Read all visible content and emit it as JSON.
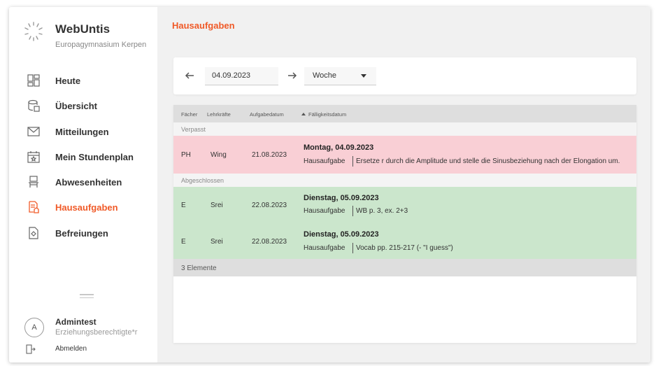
{
  "brand": {
    "name": "WebUntis",
    "school": "Europagymnasium Kerpen"
  },
  "nav": {
    "items": [
      {
        "label": "Heute",
        "icon": "dashboard-icon"
      },
      {
        "label": "Übersicht",
        "icon": "overview-icon"
      },
      {
        "label": "Mitteilungen",
        "icon": "mail-icon"
      },
      {
        "label": "Mein Stundenplan",
        "icon": "calendar-icon"
      },
      {
        "label": "Abwesenheiten",
        "icon": "chair-icon"
      },
      {
        "label": "Hausaufgaben",
        "icon": "homework-icon",
        "active": true
      },
      {
        "label": "Befreiungen",
        "icon": "exemption-icon"
      }
    ]
  },
  "user": {
    "initial": "A",
    "name": "Admintest",
    "role": "Erziehungsberechtigte*r"
  },
  "logout": {
    "label": "Abmelden"
  },
  "page": {
    "title": "Hausaufgaben"
  },
  "toolbar": {
    "date": "04.09.2023",
    "range": "Woche"
  },
  "table": {
    "headers": {
      "subject": "Fächer",
      "teacher": "Lehrkräfte",
      "assigned": "Aufgabedatum",
      "due": "Fälligkeitsdatum"
    },
    "groups": {
      "missed": "Verpasst",
      "done": "Abgeschlossen"
    },
    "rows": [
      {
        "subject": "PH",
        "teacher": "Wing",
        "assigned": "21.08.2023",
        "due_title": "Montag, 04.09.2023",
        "type": "Hausaufgabe",
        "text": "Ersetze r durch die Amplitude und stelle die Sinusbeziehung nach der Elongation um."
      },
      {
        "subject": "E",
        "teacher": "Srei",
        "assigned": "22.08.2023",
        "due_title": "Dienstag, 05.09.2023",
        "type": "Hausaufgabe",
        "text": "WB p. 3, ex. 2+3"
      },
      {
        "subject": "E",
        "teacher": "Srei",
        "assigned": "22.08.2023",
        "due_title": "Dienstag, 05.09.2023",
        "type": "Hausaufgabe",
        "text": "Vocab pp. 215-217 (- \"I guess\")"
      }
    ],
    "count_label": "3 Elemente"
  },
  "colors": {
    "accent": "#f05a28",
    "missed_row": "#f9cfd5",
    "done_row": "#cbe6cc"
  }
}
